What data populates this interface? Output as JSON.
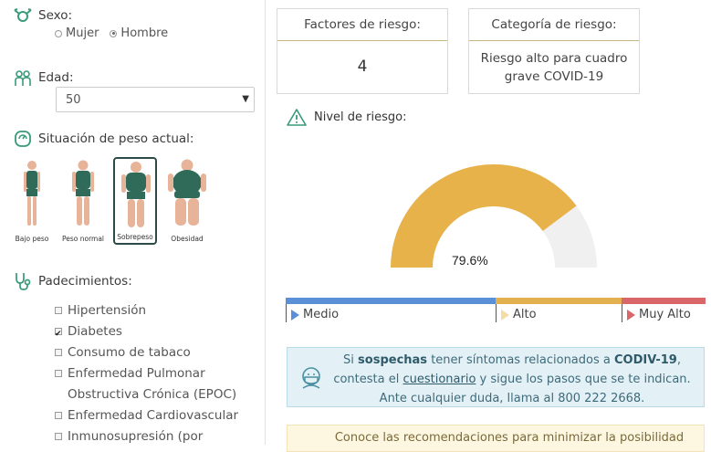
{
  "sexo": {
    "label": "Sexo:",
    "options": [
      "Mujer",
      "Hombre"
    ],
    "selected": "Hombre"
  },
  "edad": {
    "label": "Edad:",
    "value": "50"
  },
  "peso": {
    "label": "Situación de peso actual:",
    "options": [
      "Bajo peso",
      "Peso normal",
      "Sobrepeso",
      "Obesidad"
    ],
    "selected": "Sobrepeso"
  },
  "padecimientos": {
    "label": "Padecimientos:",
    "items": [
      {
        "label": "Hipertensión",
        "checked": false
      },
      {
        "label": "Diabetes",
        "checked": true
      },
      {
        "label": "Consumo de tabaco",
        "checked": false
      },
      {
        "label": "Enfermedad Pulmonar Obstructiva Crónica (EPOC)",
        "checked": false
      },
      {
        "label": "Enfermedad Cardiovascular",
        "checked": false
      },
      {
        "label": "Inmunosupresión (por",
        "checked": false
      }
    ]
  },
  "factores": {
    "label": "Factores de riesgo:",
    "value": "4"
  },
  "categoria": {
    "label": "Categoría de riesgo:",
    "value": "Riesgo alto para cuadro grave COVID-19"
  },
  "nivel": {
    "label": "Nivel de riesgo:",
    "percent_text": "79.6%",
    "percent": 79.6,
    "fill_color": "#e8b24a",
    "track_color": "#f0f0f0"
  },
  "scale": [
    {
      "label": "Medio",
      "color": "#5b8fd6"
    },
    {
      "label": "Alto",
      "color": "#e2b04f"
    },
    {
      "label": "Muy Alto",
      "color": "#d9676a"
    }
  ],
  "info": {
    "p1": "Si ",
    "b1": "sospechas",
    "p2": " tener síntomas relacionados a ",
    "b2": "CODIV-19",
    "p3": ",",
    "p4": "contesta el ",
    "link": "cuestionario",
    "p5": " y sigue los pasos que se te indican.",
    "p6": "Ante cualquier duda, llama al 800 222 2668."
  },
  "warn": {
    "text": "Conoce las recomendaciones para minimizar la posibilidad"
  }
}
